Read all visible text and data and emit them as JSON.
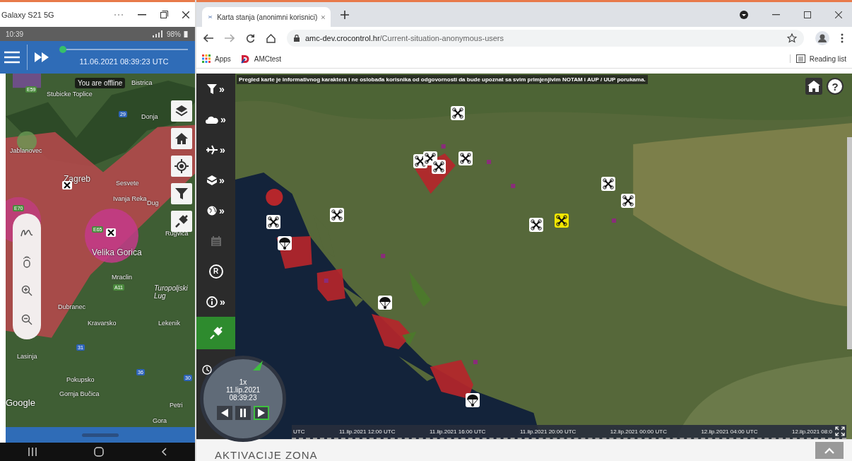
{
  "phone_window": {
    "title": "Galaxy S21 5G"
  },
  "phone_status": {
    "time": "10:39",
    "battery": "98%"
  },
  "phone_app": {
    "timestamp": "11.06.2021 08:39:23 UTC",
    "time_slider": {
      "level": 0.02
    }
  },
  "phone_map": {
    "offline_notice": "You are offline",
    "attribution": "Google",
    "places": [
      "Bistrica",
      "Stubicke Toplice",
      "Jablanovec",
      "Zagreb",
      "Sesvete",
      "Ivanja Reka",
      "Donja",
      "Dug",
      "Rugvica",
      "Velika Gorica",
      "Mraclin",
      "Turopoljski Lug",
      "Dubranec",
      "Kravarsko",
      "Lekenik",
      "Lasinja",
      "Pokupsko",
      "Gornja Bučica",
      "Petri",
      "Gora"
    ],
    "road_signs": [
      {
        "label": "E59",
        "kind": "european"
      },
      {
        "label": "29",
        "kind": "state"
      },
      {
        "label": "E70",
        "kind": "european"
      },
      {
        "label": "E65",
        "kind": "european"
      },
      {
        "label": "A11",
        "kind": "european"
      },
      {
        "label": "31",
        "kind": "state"
      },
      {
        "label": "36",
        "kind": "state"
      },
      {
        "label": "30",
        "kind": "state"
      }
    ]
  },
  "browser": {
    "tab_title": "Karta stanja (anonimni korisnici)",
    "url_host": "amc-dev.crocontrol.hr",
    "url_path": "/Current-situation-anonymous-users",
    "bookmarks": [
      "Apps",
      "AMCtest"
    ],
    "reading_list": "Reading list"
  },
  "map": {
    "disclaimer": "Pregled karte je informativnog karaktera i ne oslobađa korisnika od odgovornosti da bude upoznat sa svim primjenjivim NOTAM i AUP / UUP porukama.",
    "help": "?",
    "toolbar": [
      {
        "kind": "filter",
        "arrow": "»",
        "disabled": false,
        "selected": false
      },
      {
        "kind": "weather",
        "arrow": "»",
        "disabled": false,
        "selected": false
      },
      {
        "kind": "aircraft",
        "arrow": "»",
        "disabled": false,
        "selected": false
      },
      {
        "kind": "layers",
        "arrow": "»",
        "disabled": false,
        "selected": false
      },
      {
        "kind": "globe",
        "arrow": "»",
        "disabled": false,
        "selected": false
      },
      {
        "kind": "calendar",
        "disabled": true,
        "selected": false
      },
      {
        "kind": "registration",
        "symbol": "R",
        "disabled": false,
        "selected": false
      },
      {
        "kind": "info",
        "arrow": "»",
        "disabled": false,
        "selected": false
      },
      {
        "kind": "connection",
        "disabled": false,
        "selected": true
      }
    ],
    "markers": [
      {
        "kind": "drone"
      },
      {
        "kind": "drone"
      },
      {
        "kind": "drone"
      },
      {
        "kind": "drone"
      },
      {
        "kind": "drone"
      },
      {
        "kind": "drone"
      },
      {
        "kind": "drone"
      },
      {
        "kind": "drone"
      },
      {
        "kind": "drone"
      },
      {
        "kind": "drone"
      },
      {
        "kind": "drone-alert"
      },
      {
        "kind": "parachute"
      },
      {
        "kind": "parachute"
      },
      {
        "kind": "parachute"
      }
    ],
    "playback": {
      "speed": "1x",
      "date": "11.lip.2021",
      "time": "08:39:23",
      "buttons": [
        {
          "kind": "back",
          "selected": false
        },
        {
          "kind": "pause",
          "selected": false
        },
        {
          "kind": "play",
          "selected": true
        }
      ]
    },
    "timeline": [
      "UTC",
      "11.lip.2021 12:00 UTC",
      "11.lip.2021 16:00 UTC",
      "11.lip.2021 20:00 UTC",
      "12.lip.2021 00:00 UTC",
      "12.lip.2021 04:00 UTC",
      "12.lip.2021 08:0"
    ]
  },
  "section_heading": "AKTIVACIJE ZONA"
}
